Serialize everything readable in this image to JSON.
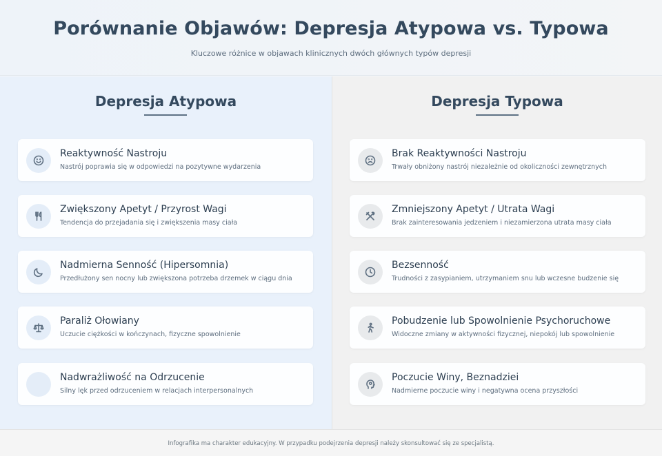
{
  "header": {
    "title": "Porównanie Objawów: Depresja Atypowa vs. Typowa",
    "subtitle": "Kluczowe różnice w objawach klinicznych dwóch głównych typów depresji"
  },
  "left": {
    "title": "Depresja Atypowa",
    "items": [
      {
        "icon": "smile-icon",
        "title": "Reaktywność Nastroju",
        "desc": "Nastrój poprawia się w odpowiedzi na pozytywne wydarzenia"
      },
      {
        "icon": "utensils-icon",
        "title": "Zwiększony Apetyt / Przyrost Wagi",
        "desc": "Tendencja do przejadania się i zwiększenia masy ciała"
      },
      {
        "icon": "moon-icon",
        "title": "Nadmierna Senność (Hipersomnia)",
        "desc": "Przedłużony sen nocny lub zwiększona potrzeba drzemek w ciągu dnia"
      },
      {
        "icon": "balance-scale-icon",
        "title": "Paraliż Ołowiany",
        "desc": "Uczucie ciężkości w kończynach, fizyczne spowolnienie"
      },
      {
        "icon": "blank-icon",
        "title": "Nadwrażliwość na Odrzucenie",
        "desc": "Silny lęk przed odrzuceniem w relacjach interpersonalnych"
      }
    ]
  },
  "right": {
    "title": "Depresja Typowa",
    "items": [
      {
        "icon": "frown-icon",
        "title": "Brak Reaktywności Nastroju",
        "desc": "Trwały obniżony nastrój niezależnie od okoliczności zewnętrznych"
      },
      {
        "icon": "crossed-utensils-icon",
        "title": "Zmniejszony Apetyt / Utrata Wagi",
        "desc": "Brak zainteresowania jedzeniem i niezamierzona utrata masy ciała"
      },
      {
        "icon": "clock-icon",
        "title": "Bezsenność",
        "desc": "Trudności z zasypianiem, utrzymaniem snu lub wczesne budzenie się"
      },
      {
        "icon": "walking-person-icon",
        "title": "Pobudzenie lub Spowolnienie Psychoruchowe",
        "desc": "Widoczne zmiany w aktywności fizycznej, niepokój lub spowolnienie"
      },
      {
        "icon": "head-brain-icon",
        "title": "Poczucie Winy, Beznadziei",
        "desc": "Nadmierne poczucie winy i negatywna ocena przyszłości"
      }
    ]
  },
  "footer": {
    "note": "Infografika ma charakter edukacyjny. W przypadku podejrzenia depresji należy skonsultować się ze specjalistą."
  }
}
